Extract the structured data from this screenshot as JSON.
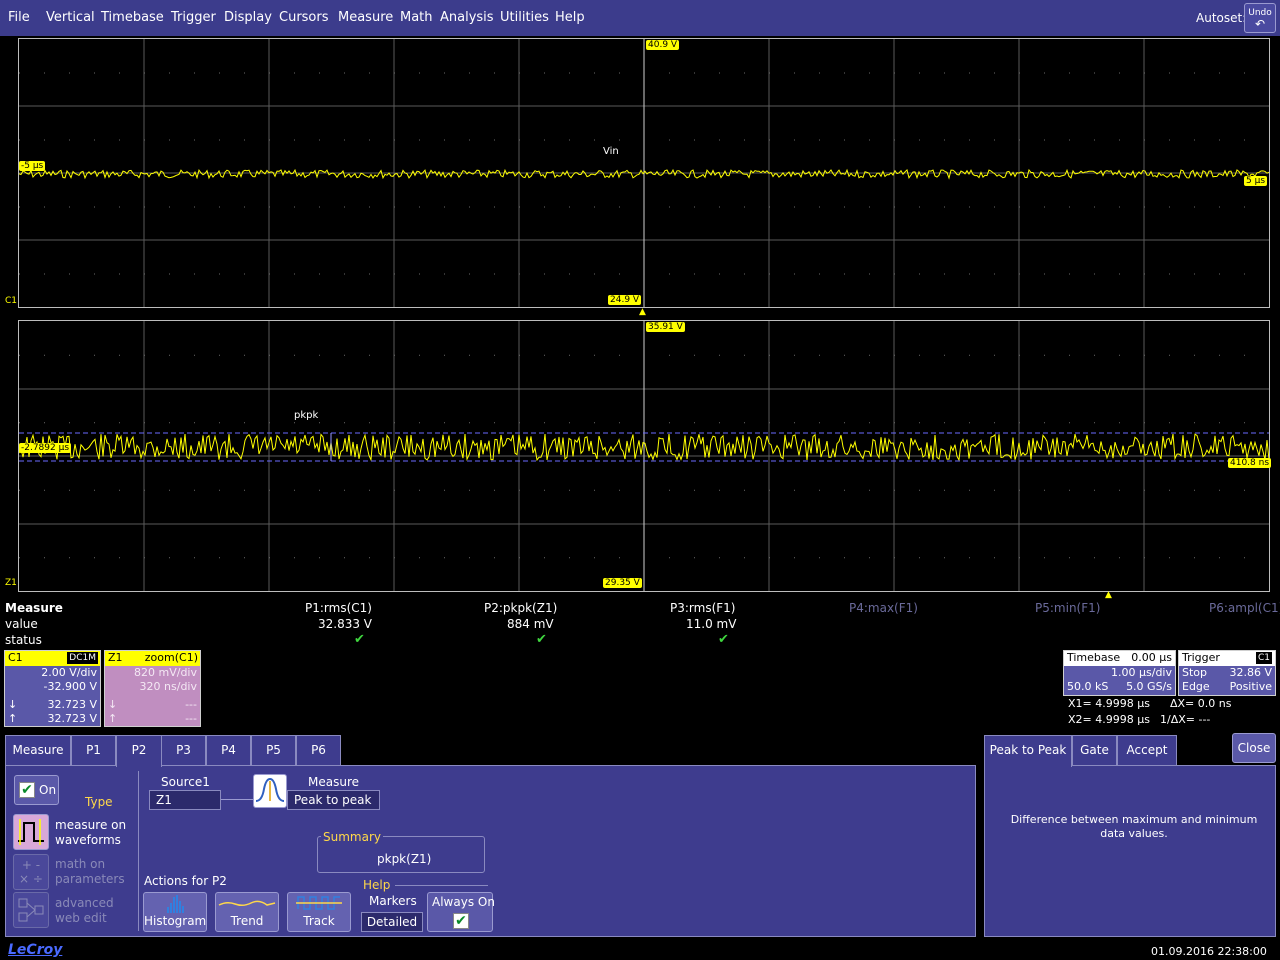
{
  "menu": [
    "File",
    "Vertical",
    "Timebase",
    "Trigger",
    "Display",
    "Cursors",
    "Measure",
    "Math",
    "Analysis",
    "Utilities",
    "Help"
  ],
  "autoset_label": "Autoset:",
  "undo_label": "Undo",
  "grid1": {
    "top_tag": "40.9 V",
    "bottom_tag": "24.9 V",
    "left_tag": "-5 µs",
    "right_tag": "5 µs",
    "trace_label": "Vin",
    "channel": "C1"
  },
  "grid2": {
    "top_tag": "35.91 V",
    "bottom_tag": "29.35 V",
    "left_tag": "-2.7892 µs",
    "right_tag": "410.8 ns",
    "trace_label": "pkpk",
    "channel": "Z1"
  },
  "measure": {
    "title": "Measure",
    "row_value": "value",
    "row_status": "status",
    "params": [
      {
        "name": "P1:rms(C1)",
        "value": "32.833 V",
        "status": "✔",
        "active": true
      },
      {
        "name": "P2:pkpk(Z1)",
        "value": "884 mV",
        "status": "✔",
        "active": true
      },
      {
        "name": "P3:rms(F1)",
        "value": "11.0 mV",
        "status": "✔",
        "active": true
      },
      {
        "name": "P4:max(F1)",
        "value": "",
        "status": "",
        "active": false
      },
      {
        "name": "P5:min(F1)",
        "value": "",
        "status": "",
        "active": false
      },
      {
        "name": "P6:ampl(C1)",
        "value": "",
        "status": "",
        "active": false
      }
    ]
  },
  "c1_box": {
    "name": "C1",
    "coupling": "DC1M",
    "vdiv": "2.00 V/div",
    "offset": "-32.900 V",
    "cur1": "32.723 V",
    "cur2": "32.723 V"
  },
  "z1_box": {
    "name": "Z1",
    "desc": "zoom(C1)",
    "vdiv": "820 mV/div",
    "tdiv": "320 ns/div",
    "cur1": "---",
    "cur2": "---"
  },
  "timebase": {
    "label": "Timebase",
    "delay": "0.00 µs",
    "tdiv": "1.00 µs/div",
    "samples": "50.0 kS",
    "rate": "5.0 GS/s"
  },
  "trigger": {
    "label": "Trigger",
    "ch": "C1",
    "mode": "Stop",
    "level": "32.86 V",
    "type": "Edge",
    "slope": "Positive"
  },
  "cursors": {
    "x1": "X1=   4.9998 µs",
    "dx": "ΔX=   0.0 ns",
    "x2": "X2=   4.9998 µs",
    "inv": "1/ΔX=       ---"
  },
  "tabs": [
    "Measure",
    "P1",
    "P2",
    "P3",
    "P4",
    "P5",
    "P6"
  ],
  "active_tab": "P2",
  "panel": {
    "on_label": "On",
    "type_label": "Type",
    "type1": "measure on waveforms",
    "type2": "math on parameters",
    "type3": "advanced web edit",
    "source_label": "Source1",
    "source_value": "Z1",
    "measure_label": "Measure",
    "measure_value": "Peak to peak",
    "summary_label": "Summary",
    "summary_value": "pkpk(Z1)",
    "actions_label": "Actions for P2",
    "histogram": "Histogram",
    "trend": "Trend",
    "track": "Track",
    "help_label": "Help",
    "markers_label": "Markers",
    "markers_value": "Detailed",
    "always_on_label": "Always On"
  },
  "rtabs": [
    "Peak to Peak",
    "Gate",
    "Accept"
  ],
  "close_label": "Close",
  "help_text": "Difference between maximum and minimum data values.",
  "brand": "LeCroy",
  "datetime": "01.09.2016 22:38:00",
  "colors": {
    "trace": "#ffff00",
    "menubar": "#3c3c8c",
    "panel": "#3e3c8e",
    "c1": "#ffff00",
    "z1": "#d8a8d8"
  }
}
